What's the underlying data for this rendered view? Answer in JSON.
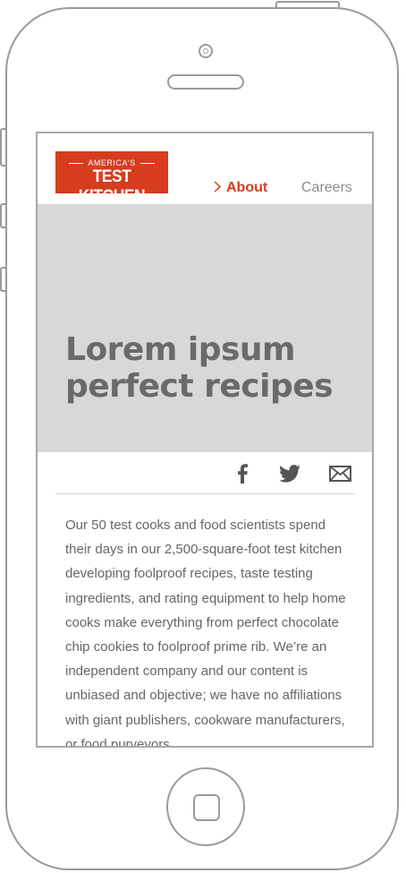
{
  "brand": {
    "logo_top": "AMERICA'S",
    "logo_main": "TEST KITCHEN",
    "accent_color": "#d63c1e"
  },
  "nav": {
    "items": [
      {
        "label": "About",
        "active": true
      },
      {
        "label": "Careers",
        "active": false
      }
    ]
  },
  "hero": {
    "title": "Lorem ipsum perfect recipes"
  },
  "social": {
    "icons": [
      "facebook-icon",
      "twitter-icon",
      "email-icon"
    ]
  },
  "content": {
    "paragraph": "Our 50 test cooks and food scientists spend their days in our 2,500-square-foot test kitchen developing foolproof recipes, taste testing ingredients, and rating equipment to help home cooks make everything from perfect chocolate chip cookies to foolproof prime rib. We’re an independent company and our content is unbiased and objective; we have no affiliations with giant publishers, cookware manufacturers, or food purveyors."
  }
}
